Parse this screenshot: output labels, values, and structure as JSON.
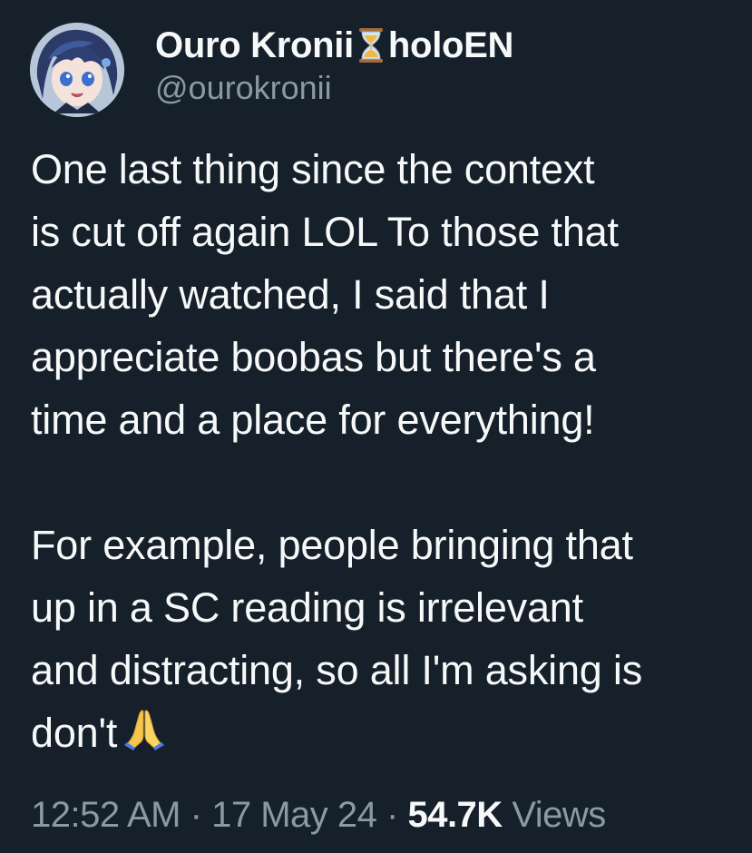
{
  "author": {
    "display_name": "Ouro Kronii",
    "display_name_suffix": "holoEN",
    "name_icon": "hourglass-icon",
    "handle": "@ourokronii",
    "avatar": "anime-avatar"
  },
  "tweet": {
    "paragraph1_lines": [
      "One last thing since the context",
      "is cut off again LOL To those that",
      "actually watched, I said that I",
      "appreciate boobas but there's a",
      "time and a place for everything!"
    ],
    "paragraph2_lines": [
      "For example, people bringing that",
      "up in a SC reading is irrelevant",
      "and distracting, so all I'm asking is",
      "don't"
    ],
    "end_emoji": "folded-hands-icon"
  },
  "meta": {
    "time": "12:52 AM",
    "separator": "·",
    "date": "17 May 24",
    "views_count": "54.7K",
    "views_label": "Views"
  },
  "colors": {
    "background": "#15202b",
    "primary_text": "#f7f9f9",
    "secondary_text": "#8b98a5"
  }
}
